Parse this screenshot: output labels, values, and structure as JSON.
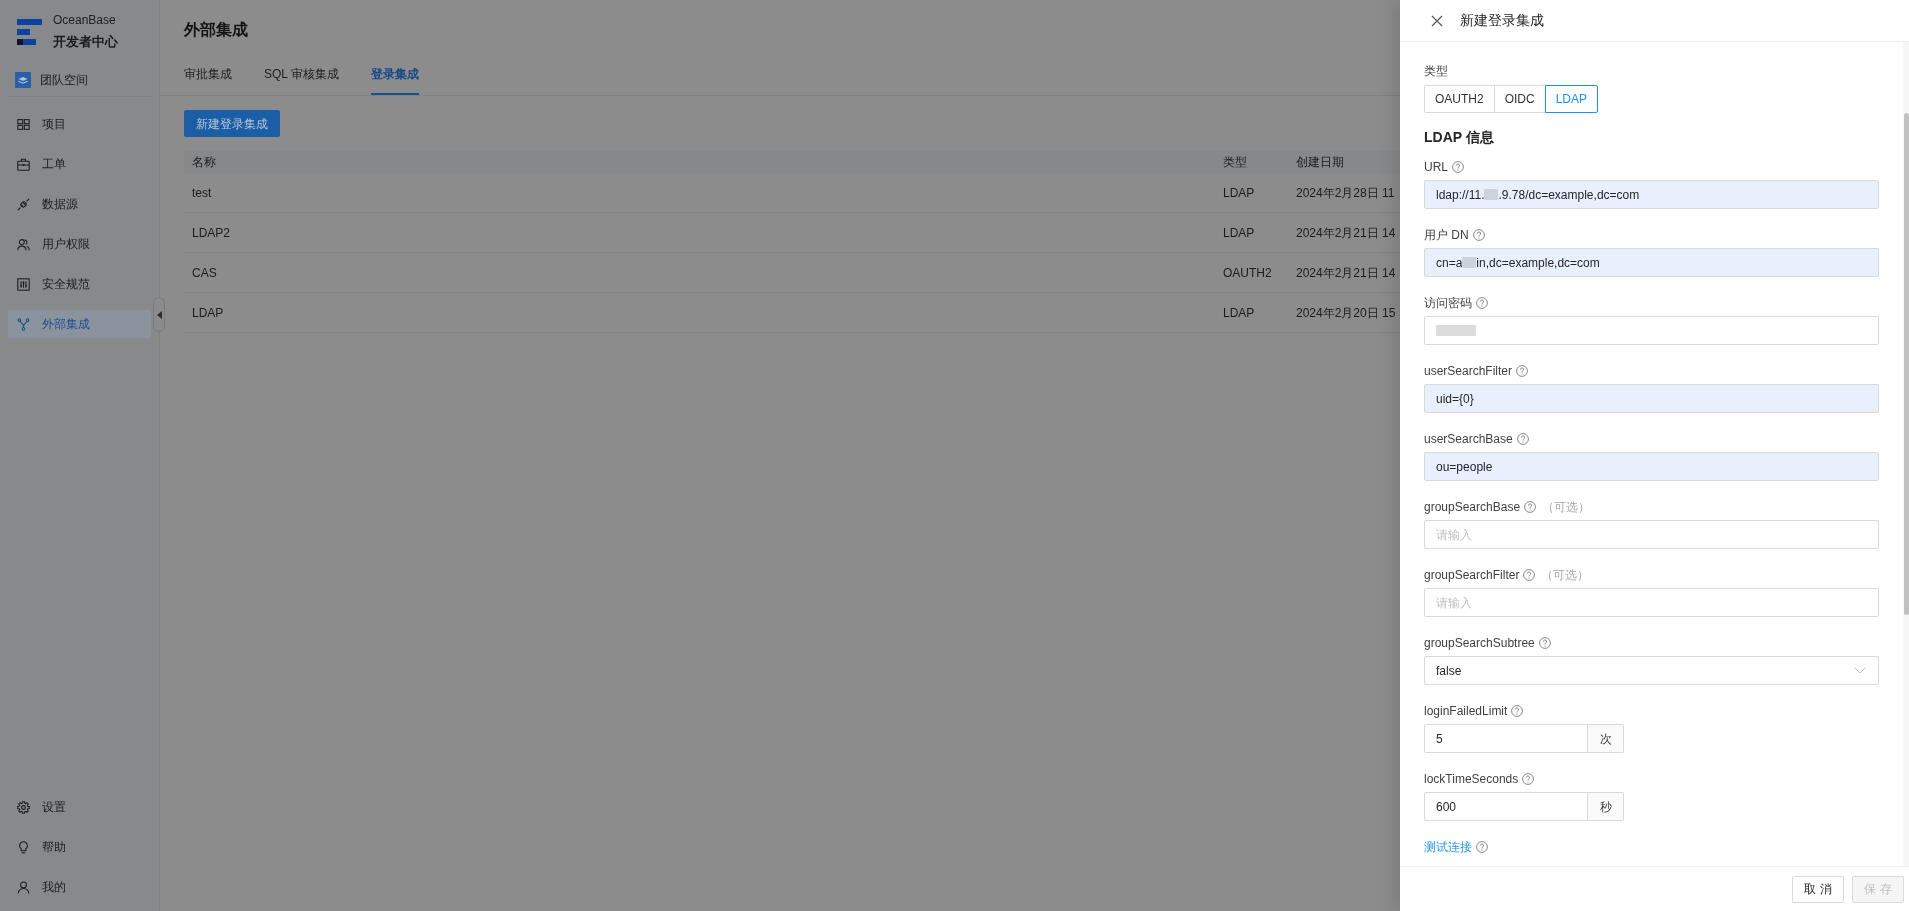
{
  "sidebar": {
    "brand": {
      "name": "OceanBase",
      "subtitle": "开发者中心"
    },
    "space": {
      "label": "团队空间"
    },
    "items": [
      {
        "label": "项目",
        "selected": false
      },
      {
        "label": "工单",
        "selected": false
      },
      {
        "label": "数据源",
        "selected": false
      },
      {
        "label": "用户权限",
        "selected": false
      },
      {
        "label": "安全规范",
        "selected": false
      },
      {
        "label": "外部集成",
        "selected": true
      }
    ],
    "bottom_items": [
      {
        "label": "设置"
      },
      {
        "label": "帮助"
      },
      {
        "label": "我的"
      }
    ]
  },
  "main": {
    "title": "外部集成",
    "tabs": [
      {
        "label": "审批集成",
        "selected": false
      },
      {
        "label": "SQL 审核集成",
        "selected": false
      },
      {
        "label": "登录集成",
        "selected": true
      }
    ],
    "new_button": "新建登录集成",
    "table": {
      "columns": [
        "名称",
        "类型",
        "创建日期"
      ],
      "rows": [
        [
          "test",
          "LDAP",
          "2024年2月28日 11"
        ],
        [
          "LDAP2",
          "LDAP",
          "2024年2月21日 14"
        ],
        [
          "CAS",
          "OAUTH2",
          "2024年2月21日 14"
        ],
        [
          "LDAP",
          "LDAP",
          "2024年2月20日 15"
        ]
      ]
    }
  },
  "drawer": {
    "title": "新建登录集成",
    "type_label": "类型",
    "types": [
      {
        "label": "OAUTH2",
        "selected": false
      },
      {
        "label": "OIDC",
        "selected": false
      },
      {
        "label": "LDAP",
        "selected": true
      }
    ],
    "section_title": "LDAP 信息",
    "fields": [
      {
        "kind": "input",
        "label": "URL",
        "autofilled": true,
        "value_parts": [
          "ldap://11.",
          ".9.78/dc=example,dc=com"
        ]
      },
      {
        "kind": "input",
        "label": "用户 DN",
        "autofilled": true,
        "value_parts": [
          "cn=a",
          "in,dc=example,dc=com"
        ]
      },
      {
        "kind": "input",
        "label": "访问密码",
        "autofilled": false,
        "redacted": true
      },
      {
        "kind": "input",
        "label": "userSearchFilter",
        "autofilled": true,
        "value": "uid={0}"
      },
      {
        "kind": "input",
        "label": "userSearchBase",
        "autofilled": true,
        "value": "ou=people"
      },
      {
        "kind": "input",
        "label": "groupSearchBase",
        "optional": "（可选）",
        "autofilled": false,
        "placeholder": "请输入"
      },
      {
        "kind": "input",
        "label": "groupSearchFilter",
        "optional": "（可选）",
        "autofilled": false,
        "placeholder": "请输入"
      },
      {
        "kind": "select",
        "label": "groupSearchSubtree",
        "autofilled": false,
        "value": "false"
      },
      {
        "kind": "unit_input",
        "label": "loginFailedLimit",
        "autofilled": false,
        "value": "5",
        "unit": "次"
      },
      {
        "kind": "unit_input",
        "label": "lockTimeSeconds",
        "autofilled": false,
        "value": "600",
        "unit": "秒"
      }
    ],
    "test_link": "测试连接",
    "buttons": [
      {
        "label": "取 消",
        "disabled": false
      },
      {
        "label": "保 存",
        "disabled": true
      }
    ]
  }
}
